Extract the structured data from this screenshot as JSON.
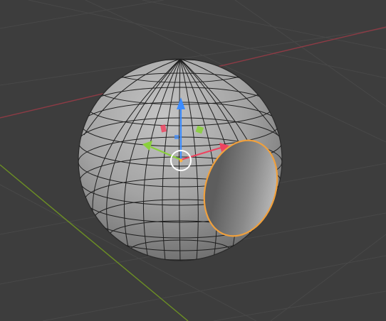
{
  "viewport": {
    "background_color": "#3d3d3d",
    "grid_line_color": "#484848",
    "x_axis_color": "#8d3b45",
    "y_axis_color": "#6c8f24"
  },
  "scene": {
    "object": "uv-sphere",
    "mesh_color": "#9a9a9a",
    "wireframe_color": "#202020",
    "selected_face_outline_color": "#f0a03c",
    "mode": "edit-mode-face-select"
  },
  "gizmo": {
    "type": "move-gizmo",
    "x_color": "#ee4460",
    "y_color": "#8ad03c",
    "z_color": "#3c8cff",
    "pivot_ring_color": "#ffffff",
    "pivot_dot_color": "#ffb040"
  }
}
